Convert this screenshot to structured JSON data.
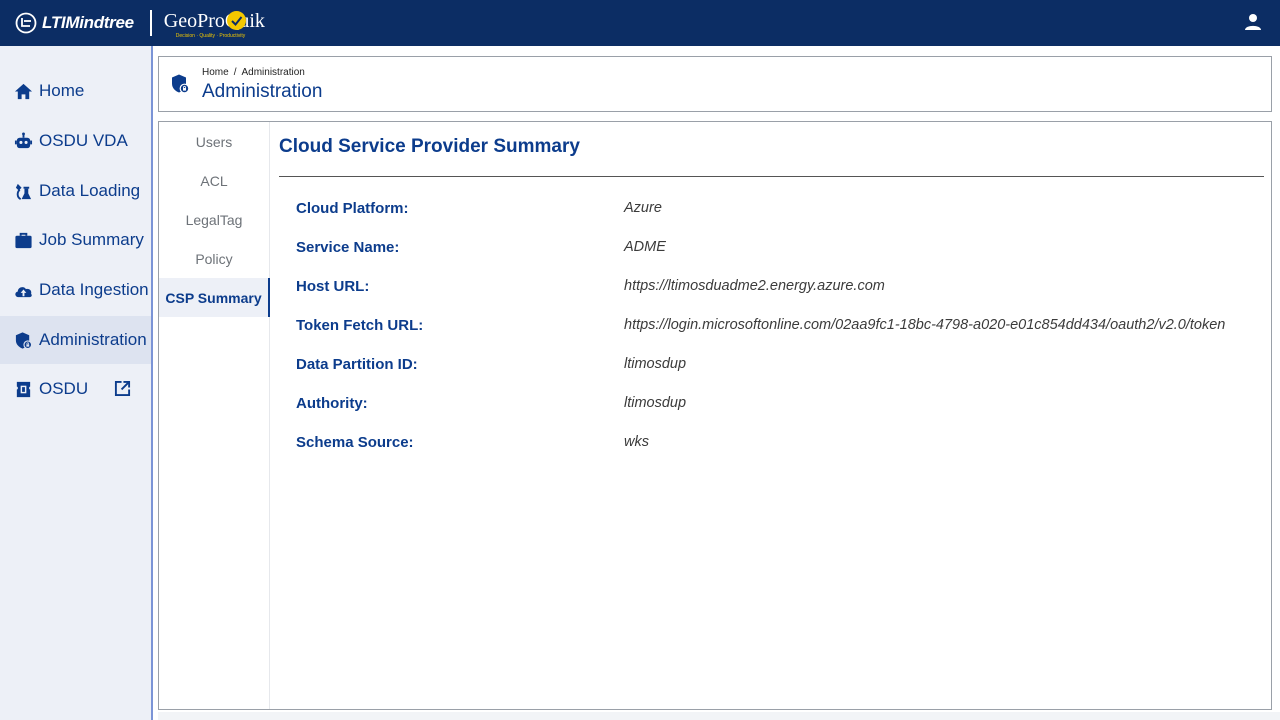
{
  "app": {
    "brand": "LTIMindtree",
    "product": "GeoProQuik",
    "product_tagline": "Decision · Quality · Productivity"
  },
  "sidebar": {
    "items": [
      {
        "label": "Home",
        "icon": "home-icon"
      },
      {
        "label": "OSDU VDA",
        "icon": "robot-icon"
      },
      {
        "label": "Data Loading",
        "icon": "flask-icon"
      },
      {
        "label": "Job Summary",
        "icon": "briefcase-icon"
      },
      {
        "label": "Data Ingestion",
        "icon": "cloud-upload-icon"
      },
      {
        "label": "Administration",
        "icon": "shield-icon",
        "active": true
      },
      {
        "label": "OSDU",
        "icon": "ticket-icon",
        "external": true
      }
    ]
  },
  "header": {
    "breadcrumb": [
      "Home",
      "Administration"
    ],
    "breadcrumb_separator": "/",
    "title": "Administration"
  },
  "tabs": [
    {
      "label": "Users"
    },
    {
      "label": "ACL"
    },
    {
      "label": "LegalTag"
    },
    {
      "label": "Policy"
    },
    {
      "label": "CSP Summary",
      "active": true
    }
  ],
  "csp": {
    "title": "Cloud Service Provider Summary",
    "fields": [
      {
        "label": "Cloud Platform:",
        "value": "Azure"
      },
      {
        "label": "Service Name:",
        "value": "ADME"
      },
      {
        "label": "Host URL:",
        "value": "https://ltimosduadme2.energy.azure.com"
      },
      {
        "label": "Token Fetch URL:",
        "value": "https://login.microsoftonline.com/02aa9fc1-18bc-4798-a020-e01c854dd434/oauth2/v2.0/token"
      },
      {
        "label": "Data Partition ID:",
        "value": "ltimosdup"
      },
      {
        "label": "Authority:",
        "value": "ltimosdup"
      },
      {
        "label": "Schema Source:",
        "value": "wks"
      }
    ]
  },
  "colors": {
    "topbar": "#0c2d64",
    "accent": "#0c3c8c",
    "logo_accent": "#f3c800"
  }
}
